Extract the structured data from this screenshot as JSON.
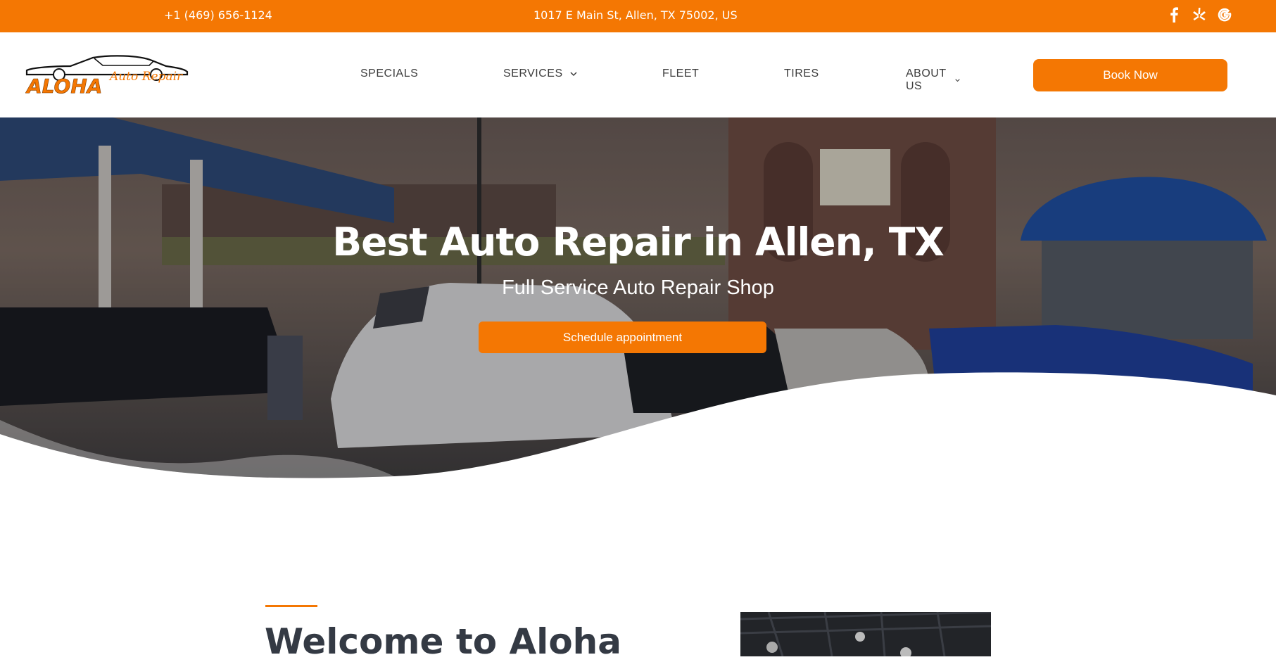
{
  "topbar": {
    "phone": "+1 (469) 656-1124",
    "address": "1017 E Main St, Allen, TX 75002, US",
    "socials": [
      {
        "name": "facebook-icon",
        "glyph": "f"
      },
      {
        "name": "yelp-icon",
        "glyph": "✽"
      },
      {
        "name": "google-icon",
        "glyph": "G"
      }
    ]
  },
  "header": {
    "logo": {
      "brand": "ALOHA",
      "sub": "Auto Repair"
    },
    "nav": [
      {
        "label": "SPECIALS",
        "dropdown": false
      },
      {
        "label": "SERVICES",
        "dropdown": true
      },
      {
        "label": "FLEET",
        "dropdown": false
      },
      {
        "label": "TIRES",
        "dropdown": false
      },
      {
        "label": "ABOUT US",
        "dropdown": true
      }
    ],
    "cta": "Book Now"
  },
  "hero": {
    "title": "Best Auto Repair in Allen, TX",
    "subtitle": "Full Service Auto Repair Shop",
    "button": "Schedule appointment"
  },
  "welcome": {
    "title": "Welcome to Aloha"
  },
  "colors": {
    "accent": "#f47703",
    "heading": "#343a44"
  }
}
